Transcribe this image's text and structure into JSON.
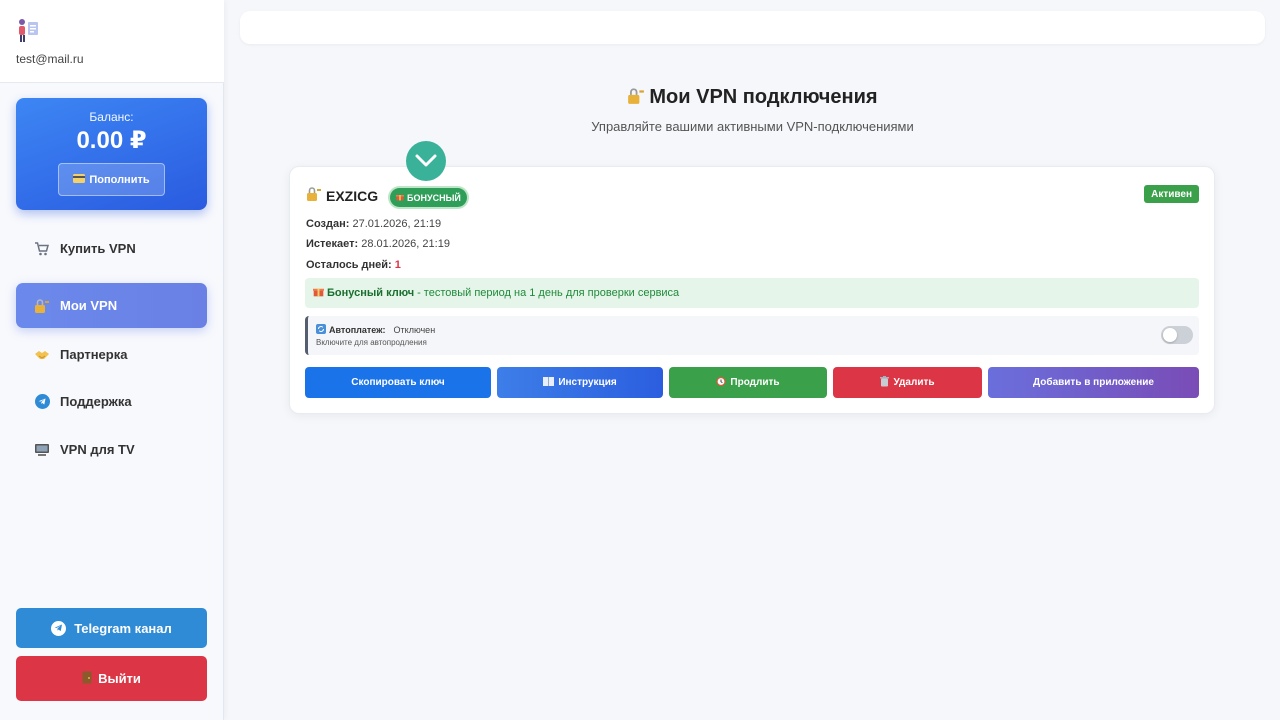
{
  "sidebar": {
    "user_email": "test@mail.ru",
    "balance": {
      "label": "Баланс:",
      "value": "0.00 ₽",
      "topup_label": "Пополнить"
    },
    "nav": [
      {
        "label": "Купить VPN",
        "icon": "cart-icon",
        "active": false
      },
      {
        "label": "Мои VPN",
        "icon": "lock-key-icon",
        "active": true
      },
      {
        "label": "Партнерка",
        "icon": "handshake-icon",
        "active": false
      },
      {
        "label": "Поддержка",
        "icon": "telegram-icon",
        "active": false
      },
      {
        "label": "VPN для TV",
        "icon": "tv-icon",
        "active": false
      }
    ],
    "telegram_label": "Telegram канал",
    "logout_label": "Выйти"
  },
  "main": {
    "title": "Мои VPN подключения",
    "subtitle": "Управляйте вашими активными VPN-подключениями",
    "card": {
      "key_name": "EXZICG",
      "bonus_badge": "БОНУСНЫЙ",
      "status": "Активен",
      "created_label": "Создан:",
      "created_value": "27.01.2026, 21:19",
      "expires_label": "Истекает:",
      "expires_value": "28.01.2026, 21:19",
      "days_label": "Осталось дней:",
      "days_value": "1",
      "bonus_note_title": "Бонусный ключ",
      "bonus_note_text": "- тестовый период на 1 день для проверки сервиса",
      "autopay_title": "Автоплатеж:",
      "autopay_state": "Отключен",
      "autopay_hint": "Включите для автопродления",
      "autopay_enabled": false,
      "buttons": {
        "copy": "Скопировать ключ",
        "guide": "Инструкция",
        "extend": "Продлить",
        "delete": "Удалить",
        "add_to_app": "Добавить в приложение"
      }
    }
  },
  "colors": {
    "accent": "#2a5be0",
    "active_nav": "#6b89ec",
    "success": "#3aa04a",
    "danger": "#dc3545",
    "telegram": "#2f8bd6",
    "check_badge": "#3ab29a"
  }
}
